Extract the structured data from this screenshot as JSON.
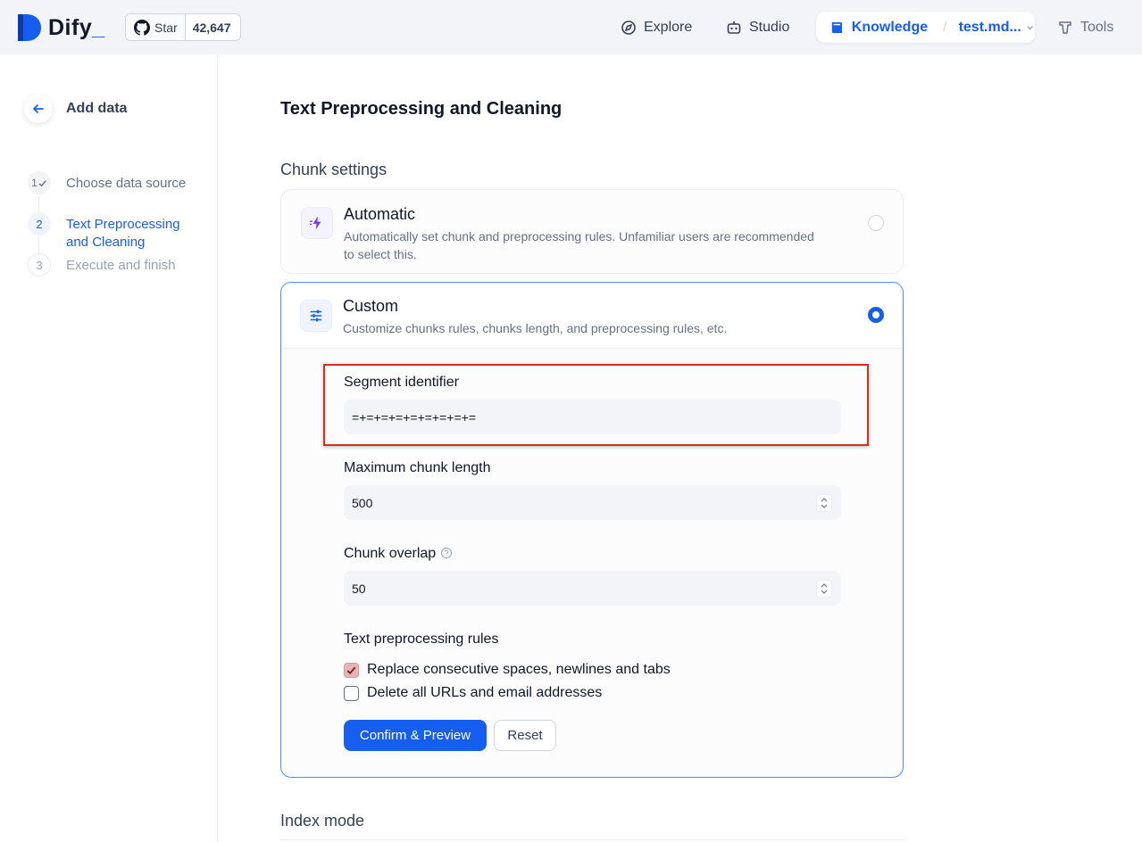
{
  "header": {
    "logo_text": "Dify",
    "logo_suffix": "_",
    "github_star_label": "Star",
    "github_star_count": "42,647",
    "nav": {
      "explore": "Explore",
      "studio": "Studio",
      "knowledge": "Knowledge",
      "dataset": "test.md...",
      "tools": "Tools"
    }
  },
  "sidebar": {
    "title": "Add data",
    "steps": [
      {
        "number": "1",
        "label": "Choose data source",
        "status": "done"
      },
      {
        "number": "2",
        "label": "Text Preprocessing and Cleaning",
        "status": "active"
      },
      {
        "number": "3",
        "label": "Execute and finish",
        "status": "pending"
      }
    ]
  },
  "main": {
    "title": "Text Preprocessing and Cleaning",
    "chunk_settings_label": "Chunk settings",
    "automatic": {
      "title": "Automatic",
      "description": "Automatically set chunk and preprocessing rules. Unfamiliar users are recommended to select this.",
      "selected": false
    },
    "custom": {
      "title": "Custom",
      "description": "Customize chunks rules, chunks length, and preprocessing rules, etc.",
      "selected": true,
      "segment_identifier_label": "Segment identifier",
      "segment_identifier_value": "=+=+=+=+=+=+=+=+=",
      "max_chunk_length_label": "Maximum chunk length",
      "max_chunk_length_value": "500",
      "chunk_overlap_label": "Chunk overlap",
      "chunk_overlap_value": "50",
      "rules_label": "Text preprocessing rules",
      "rules": [
        {
          "label": "Replace consecutive spaces, newlines and tabs",
          "checked": true
        },
        {
          "label": "Delete all URLs and email addresses",
          "checked": false
        }
      ],
      "confirm_label": "Confirm & Preview",
      "reset_label": "Reset"
    },
    "index_mode_label": "Index mode"
  },
  "colors": {
    "accent": "#155eef",
    "highlight_border": "#d92d20",
    "header_bg": "#f2f4f7"
  }
}
